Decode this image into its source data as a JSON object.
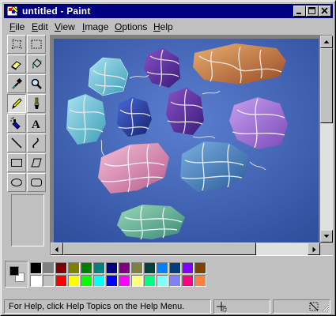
{
  "window": {
    "title": "untitled - Paint"
  },
  "menu": {
    "items": [
      {
        "label": "File",
        "key": "F",
        "rest": "ile"
      },
      {
        "label": "Edit",
        "key": "E",
        "rest": "dit"
      },
      {
        "label": "View",
        "key": "V",
        "rest": "iew"
      },
      {
        "label": "Image",
        "key": "I",
        "rest": "mage"
      },
      {
        "label": "Options",
        "key": "O",
        "rest": "ptions"
      },
      {
        "label": "Help",
        "key": "H",
        "rest": "elp"
      }
    ]
  },
  "toolbox": {
    "tools": [
      {
        "name": "free-form-select",
        "icon": "free-form-select-icon",
        "pressed": false
      },
      {
        "name": "select",
        "icon": "rect-select-icon",
        "pressed": false
      },
      {
        "name": "eraser",
        "icon": "eraser-icon",
        "pressed": false
      },
      {
        "name": "fill-with-color",
        "icon": "paint-bucket-icon",
        "pressed": false
      },
      {
        "name": "pick-color",
        "icon": "eyedropper-icon",
        "pressed": false
      },
      {
        "name": "magnifier",
        "icon": "magnifier-icon",
        "pressed": false
      },
      {
        "name": "pencil",
        "icon": "pencil-icon",
        "pressed": true
      },
      {
        "name": "brush",
        "icon": "brush-icon",
        "pressed": false
      },
      {
        "name": "airbrush",
        "icon": "airbrush-icon",
        "pressed": false
      },
      {
        "name": "text",
        "icon": "text-icon",
        "pressed": false
      },
      {
        "name": "line",
        "icon": "line-icon",
        "pressed": false
      },
      {
        "name": "curve",
        "icon": "curve-icon",
        "pressed": false
      },
      {
        "name": "rectangle",
        "icon": "rectangle-icon",
        "pressed": false
      },
      {
        "name": "polygon",
        "icon": "polygon-icon",
        "pressed": false
      },
      {
        "name": "ellipse",
        "icon": "ellipse-icon",
        "pressed": false
      },
      {
        "name": "rounded-rectangle",
        "icon": "rounded-rectangle-icon",
        "pressed": false
      }
    ]
  },
  "colors": {
    "foreground": "#000000",
    "background": "#ffffff",
    "palette_top": [
      "#000000",
      "#808080",
      "#800000",
      "#808000",
      "#008000",
      "#008080",
      "#000080",
      "#800080",
      "#808040",
      "#004040",
      "#0080ff",
      "#004080",
      "#8000ff",
      "#804000"
    ],
    "palette_bottom": [
      "#ffffff",
      "#c0c0c0",
      "#ff0000",
      "#ffff00",
      "#00ff00",
      "#00ffff",
      "#0000ff",
      "#ff00ff",
      "#ffff80",
      "#00ff80",
      "#80ffff",
      "#8080ff",
      "#ff0080",
      "#ff8040"
    ],
    "canvas_bg": "#3e64b5"
  },
  "status": {
    "help_text": "For Help, click Help Topics on the Help Menu."
  }
}
